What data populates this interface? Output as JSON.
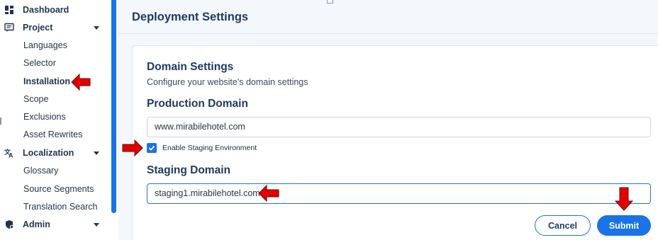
{
  "sidebar": {
    "items": [
      {
        "label": "Dashboard",
        "icon": "dashboard-icon"
      },
      {
        "label": "Project",
        "icon": "project-icon",
        "expanded": true
      },
      {
        "label": "Languages"
      },
      {
        "label": "Selector"
      },
      {
        "label": "Installation",
        "active": true
      },
      {
        "label": "Scope"
      },
      {
        "label": "Exclusions"
      },
      {
        "label": "Asset Rewrites"
      },
      {
        "label": "Localization",
        "icon": "translate-icon",
        "expanded": true
      },
      {
        "label": "Glossary"
      },
      {
        "label": "Source Segments"
      },
      {
        "label": "Translation Search"
      },
      {
        "label": "Admin",
        "icon": "admin-shield-icon",
        "expanded": true
      }
    ]
  },
  "main": {
    "title": "Deployment Settings",
    "domain_settings": {
      "heading": "Domain Settings",
      "description": "Configure your website's domain settings"
    },
    "production": {
      "heading": "Production Domain",
      "value": "www.mirabilehotel.com"
    },
    "staging_toggle": {
      "label": "Enable Staging Environment",
      "checked": true
    },
    "staging": {
      "heading": "Staging Domain",
      "value": "staging1.mirabilehotel.com"
    },
    "buttons": {
      "cancel": "Cancel",
      "submit": "Submit"
    }
  },
  "colors": {
    "accent": "#1a73e8",
    "heading": "#1d3a5f",
    "annotation_arrow": "#e00000"
  }
}
